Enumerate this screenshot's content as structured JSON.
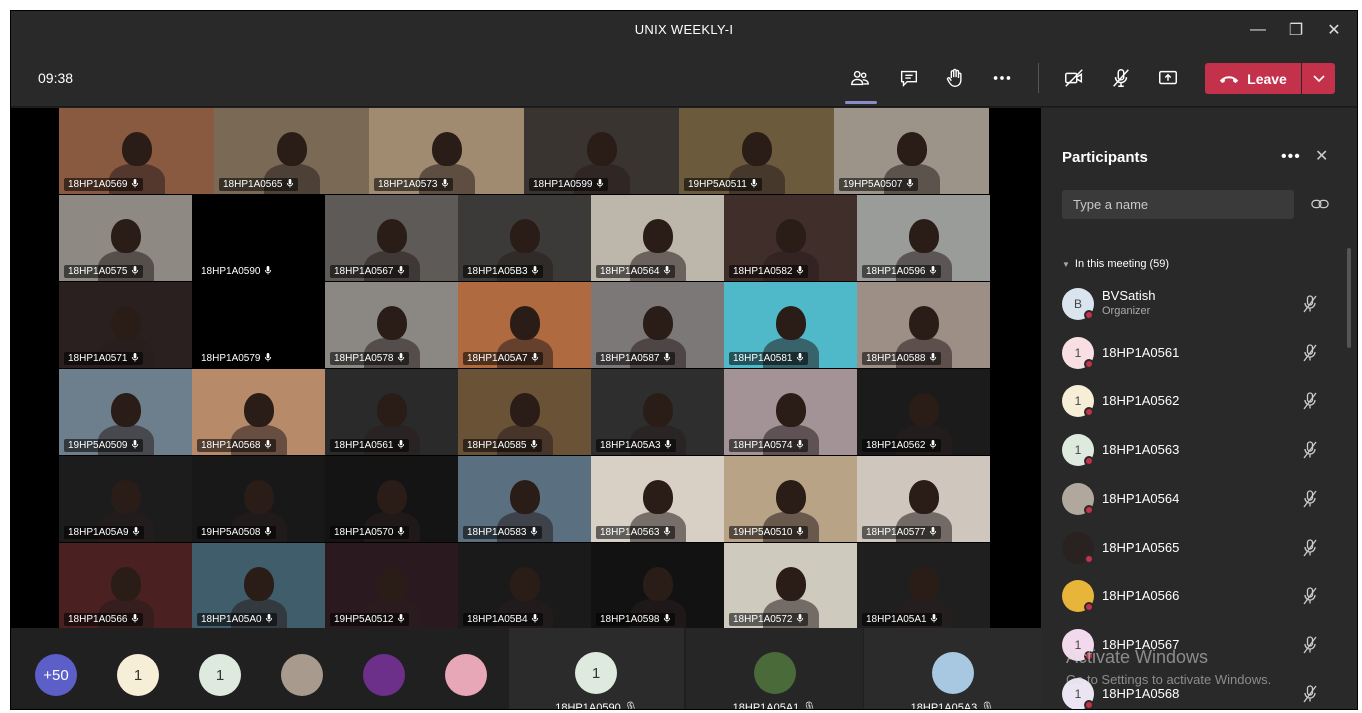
{
  "window": {
    "title": "UNIX WEEKLY-I",
    "controls": {
      "minimize": "—",
      "restore": "❐",
      "close": "✕"
    }
  },
  "toolbar": {
    "timer": "09:38",
    "leave_label": "Leave",
    "icons": [
      "participants-icon",
      "chat-icon",
      "raise-hand-icon",
      "more-options-icon",
      "camera-off-icon",
      "mic-off-icon",
      "share-screen-icon"
    ]
  },
  "grid": {
    "tiles": [
      {
        "name": "18HP1A0569",
        "bg": "#8a5a40"
      },
      {
        "name": "18HP1A0565",
        "bg": "#7a6a55"
      },
      {
        "name": "18HP1A0573",
        "bg": "#a08b70"
      },
      {
        "name": "18HP1A0599",
        "bg": "#3a3430"
      },
      {
        "name": "19HP5A0511",
        "bg": "#6b5a3c"
      },
      {
        "name": "19HP5A0507",
        "bg": "#9c9488"
      },
      {
        "name": "18HP1A0575",
        "bg": "#8e8a83"
      },
      {
        "name": "18HP1A0590",
        "bg": "#000000"
      },
      {
        "name": "18HP1A0567",
        "bg": "#5e5a58"
      },
      {
        "name": "18HP1A05B3",
        "bg": "#3b3a38"
      },
      {
        "name": "18HP1A0564",
        "bg": "#bdb6aa"
      },
      {
        "name": "18HP1A0582",
        "bg": "#402e2a"
      },
      {
        "name": "18HP1A0596",
        "bg": "#9a9c9a"
      },
      {
        "name": "18HP1A0571",
        "bg": "#2a2020"
      },
      {
        "name": "18HP1A0579",
        "bg": "#000000"
      },
      {
        "name": "18HP1A0578",
        "bg": "#8b8883"
      },
      {
        "name": "18HP1A05A7",
        "bg": "#b06a40"
      },
      {
        "name": "18HP1A0587",
        "bg": "#7c7878"
      },
      {
        "name": "18HP1A0581",
        "bg": "#4fb9c9"
      },
      {
        "name": "18HP1A0588",
        "bg": "#9d8f85"
      },
      {
        "name": "19HP5A0509",
        "bg": "#6d7f8c"
      },
      {
        "name": "18HP1A0568",
        "bg": "#b78a6a"
      },
      {
        "name": "18HP1A0561",
        "bg": "#2a2a2a"
      },
      {
        "name": "18HP1A0585",
        "bg": "#6a5236"
      },
      {
        "name": "18HP1A05A3",
        "bg": "#2e2e2e"
      },
      {
        "name": "18HP1A0574",
        "bg": "#a39397"
      },
      {
        "name": "18HP1A0562",
        "bg": "#1b1b1b"
      },
      {
        "name": "18HP1A05A9",
        "bg": "#1c1c1c"
      },
      {
        "name": "19HP5A0508",
        "bg": "#181818"
      },
      {
        "name": "18HP1A0570",
        "bg": "#141414"
      },
      {
        "name": "18HP1A0583",
        "bg": "#5a6f80"
      },
      {
        "name": "18HP1A0563",
        "bg": "#d8d0c5"
      },
      {
        "name": "19HP5A0510",
        "bg": "#b8a387"
      },
      {
        "name": "18HP1A0577",
        "bg": "#cfc7bd"
      },
      {
        "name": "18HP1A0566",
        "bg": "#4a2020"
      },
      {
        "name": "18HP1A05A0",
        "bg": "#3f5d6b"
      },
      {
        "name": "19HP5A0512",
        "bg": "#2a1a20"
      },
      {
        "name": "18HP1A05B4",
        "bg": "#1a1a1a"
      },
      {
        "name": "18HP1A0598",
        "bg": "#121212"
      },
      {
        "name": "18HP1A0572",
        "bg": "#cfcabe"
      },
      {
        "name": "18HP1A05A1",
        "bg": "#1f1f1f"
      }
    ]
  },
  "strip": {
    "overflow_label": "+50",
    "avatars": [
      {
        "initial": "1",
        "color": "#f6eed7"
      },
      {
        "initial": "1",
        "color": "#dfeadf"
      },
      {
        "initial": "",
        "color": "#a89b8e"
      },
      {
        "initial": "",
        "color": "#6c2f8a"
      },
      {
        "initial": "",
        "color": "#e7a7b6"
      }
    ],
    "spotlights": [
      {
        "name": "18HP1A0590",
        "initial": "1",
        "color": "#dfeadf"
      },
      {
        "name": "18HP1A05A1",
        "initial": "",
        "color": "#4a6a3a"
      },
      {
        "name": "18HP1A05A3",
        "initial": "",
        "color": "#a7c8e0"
      }
    ]
  },
  "panel": {
    "title": "Participants",
    "more": "•••",
    "close": "✕",
    "search_placeholder": "Type a name",
    "section_label": "In this meeting (59)",
    "people": [
      {
        "initial": "B",
        "name": "BVSatish",
        "role": "Organizer",
        "color": "#d9e4ee"
      },
      {
        "initial": "1",
        "name": "18HP1A0561",
        "role": "",
        "color": "#f7dfe3"
      },
      {
        "initial": "1",
        "name": "18HP1A0562",
        "role": "",
        "color": "#f6eed7"
      },
      {
        "initial": "1",
        "name": "18HP1A0563",
        "role": "",
        "color": "#dfeadf"
      },
      {
        "initial": "",
        "name": "18HP1A0564",
        "role": "",
        "color": "#b0a89c"
      },
      {
        "initial": "",
        "name": "18HP1A0565",
        "role": "",
        "color": "#2a2220"
      },
      {
        "initial": "",
        "name": "18HP1A0566",
        "role": "",
        "color": "#e6b53a"
      },
      {
        "initial": "1",
        "name": "18HP1A0567",
        "role": "",
        "color": "#f2d9ec"
      },
      {
        "initial": "1",
        "name": "18HP1A0568",
        "role": "",
        "color": "#ebe4f2"
      }
    ]
  },
  "watermark": {
    "line1": "Activate Windows",
    "line2": "Go to Settings to activate Windows."
  },
  "colors": {
    "accent": "#8b8cc7",
    "leave": "#c4314b",
    "background": "#1f1f1f"
  }
}
